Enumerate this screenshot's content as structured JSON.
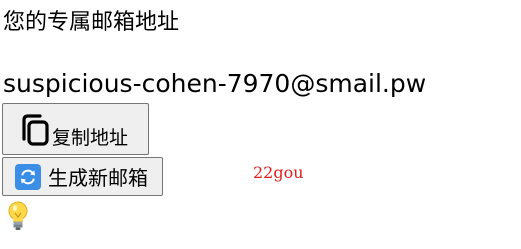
{
  "heading": "您的专属邮箱地址",
  "email": "suspicious-cohen-7970@smail.pw",
  "buttons": {
    "copy_label": "复制地址",
    "copy_icon": "copy-icon",
    "new_label": "生成新邮箱",
    "new_icon": "refresh-icon"
  },
  "watermark": "22gou",
  "tip_icon": "lightbulb-icon",
  "colors": {
    "watermark": "#e01c1c",
    "refresh_icon_bg": "#3b8ee6",
    "button_bg": "#efefef",
    "button_border": "#767676"
  }
}
